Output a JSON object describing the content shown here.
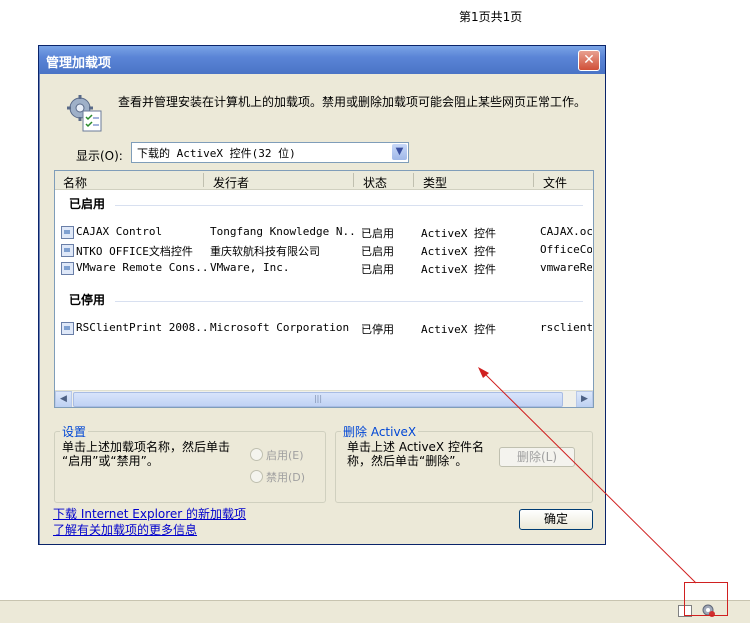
{
  "page_header": "第1页共1页",
  "dialog": {
    "title": "管理加载项",
    "close_label": "✕",
    "description": "查看并管理安装在计算机上的加载项。禁用或删除加载项可能会阻止某些网页正常工作。",
    "show_label": "显示(O):",
    "show_value": "下载的 ActiveX 控件(32 位)",
    "columns": [
      "名称",
      "发行者",
      "状态",
      "类型",
      "文件"
    ],
    "groups": {
      "enabled": "已启用",
      "disabled": "已停用"
    },
    "rows": [
      {
        "name": "CAJAX Control",
        "publisher": "Tongfang Knowledge N...",
        "status": "已启用",
        "type": "ActiveX 控件",
        "file": "CAJAX.ocx"
      },
      {
        "name": "NTKO OFFICE文档控件",
        "publisher": "重庆软航科技有限公司",
        "status": "已启用",
        "type": "ActiveX 控件",
        "file": "OfficeCon"
      },
      {
        "name": "VMware Remote Cons...",
        "publisher": "VMware, Inc.",
        "status": "已启用",
        "type": "ActiveX 控件",
        "file": "vmwareRem"
      },
      {
        "name": "RSClientPrint 2008...",
        "publisher": "Microsoft Corporation",
        "status": "已停用",
        "type": "ActiveX 控件",
        "file": "rsclientp"
      }
    ],
    "settings": {
      "title": "设置",
      "text_line1": "单击上述加载项名称，然后单击",
      "text_line2": "“启用”或“禁用”。",
      "enable_label": "启用(E)",
      "disable_label": "禁用(D)"
    },
    "delete": {
      "title": "删除 ActiveX",
      "text_line1": "单击上述 ActiveX 控件名",
      "text_line2": "称，然后单击“删除”。",
      "button_label": "删除(L)"
    },
    "links": {
      "download": "下载 Internet Explorer 的新加载项",
      "learn_more": "了解有关加载项的更多信息"
    },
    "ok_label": "确定"
  },
  "colors": {
    "title_bar": "#5a84d6",
    "link": "#0000cc",
    "group_title": "#0046d5",
    "annotation": "#d02020"
  }
}
